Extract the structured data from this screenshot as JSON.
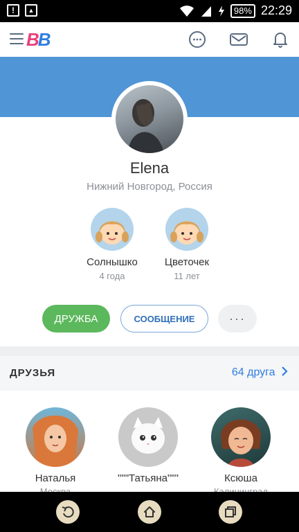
{
  "status_bar": {
    "battery": "98%",
    "time": "22:29"
  },
  "app": {
    "logo_text_1": "B",
    "logo_text_2": "B",
    "accent_color": "#5095d6",
    "brand_pink": "#e8407a",
    "brand_blue": "#2f7de1"
  },
  "profile": {
    "name": "Elena",
    "city": "Нижний Новгород, Россия",
    "children": [
      {
        "name": "Солнышко",
        "age": "4 года"
      },
      {
        "name": "Цветочек",
        "age": "11 лет"
      }
    ]
  },
  "actions": {
    "friend_label": "ДРУЖБА",
    "message_label": "СООБЩЕНИЕ",
    "more_label": "···"
  },
  "friends": {
    "title": "ДРУЗЬЯ",
    "count_label": "64 друга",
    "items": [
      {
        "name": "Наталья",
        "city": "Москва"
      },
      {
        "name": "\"\"\"Татьяна\"\"\"",
        "city": ""
      },
      {
        "name": "Ксюша",
        "city": "Калининград"
      }
    ]
  }
}
